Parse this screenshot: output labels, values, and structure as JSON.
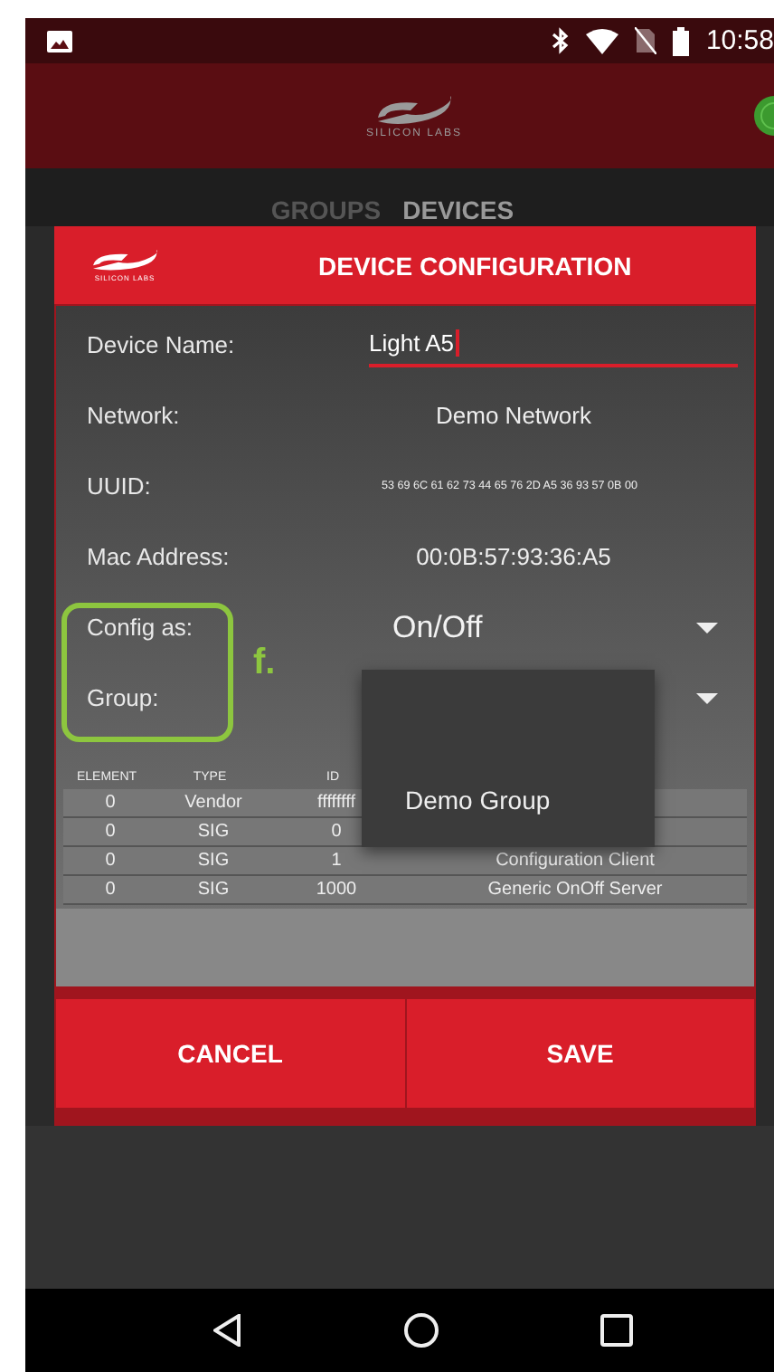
{
  "status_bar": {
    "time": "10:58"
  },
  "app_bar": {
    "logo_text": "SILICON LABS"
  },
  "tabs": [
    {
      "label": "GROUPS",
      "selected": false
    },
    {
      "label": "DEVICES",
      "selected": true
    }
  ],
  "dialog": {
    "logo_text": "SILICON LABS",
    "title": "DEVICE CONFIGURATION",
    "fields": [
      {
        "kind": "input",
        "label": "Device Name:",
        "value": "Light A5"
      },
      {
        "kind": "text",
        "label": "Network:",
        "value": "Demo Network"
      },
      {
        "kind": "small",
        "label": "UUID:",
        "value": "53 69 6C 61 62 73 44 65 76 2D A5 36 93 57 0B 00"
      },
      {
        "kind": "text",
        "label": "Mac Address:",
        "value": "00:0B:57:93:36:A5"
      },
      {
        "kind": "dropdown",
        "label": "Config as:",
        "value": "On/Off"
      },
      {
        "kind": "dropdown",
        "label": "Group:"
      }
    ],
    "table": {
      "columns": [
        "ELEMENT",
        "TYPE",
        "ID"
      ],
      "rows": [
        [
          "0",
          "Vendor",
          "ffffffff"
        ],
        [
          "0",
          "SIG",
          "0"
        ],
        [
          "0",
          "SIG",
          "1",
          "Configuration Client"
        ],
        [
          "0",
          "SIG",
          "1000",
          "Generic OnOff Server"
        ]
      ]
    },
    "dropdown_menu": {
      "items": [
        "Demo Group"
      ]
    },
    "buttons": [
      {
        "label": "CANCEL"
      },
      {
        "label": "SAVE"
      }
    ]
  },
  "annotation": {
    "label": "f."
  }
}
